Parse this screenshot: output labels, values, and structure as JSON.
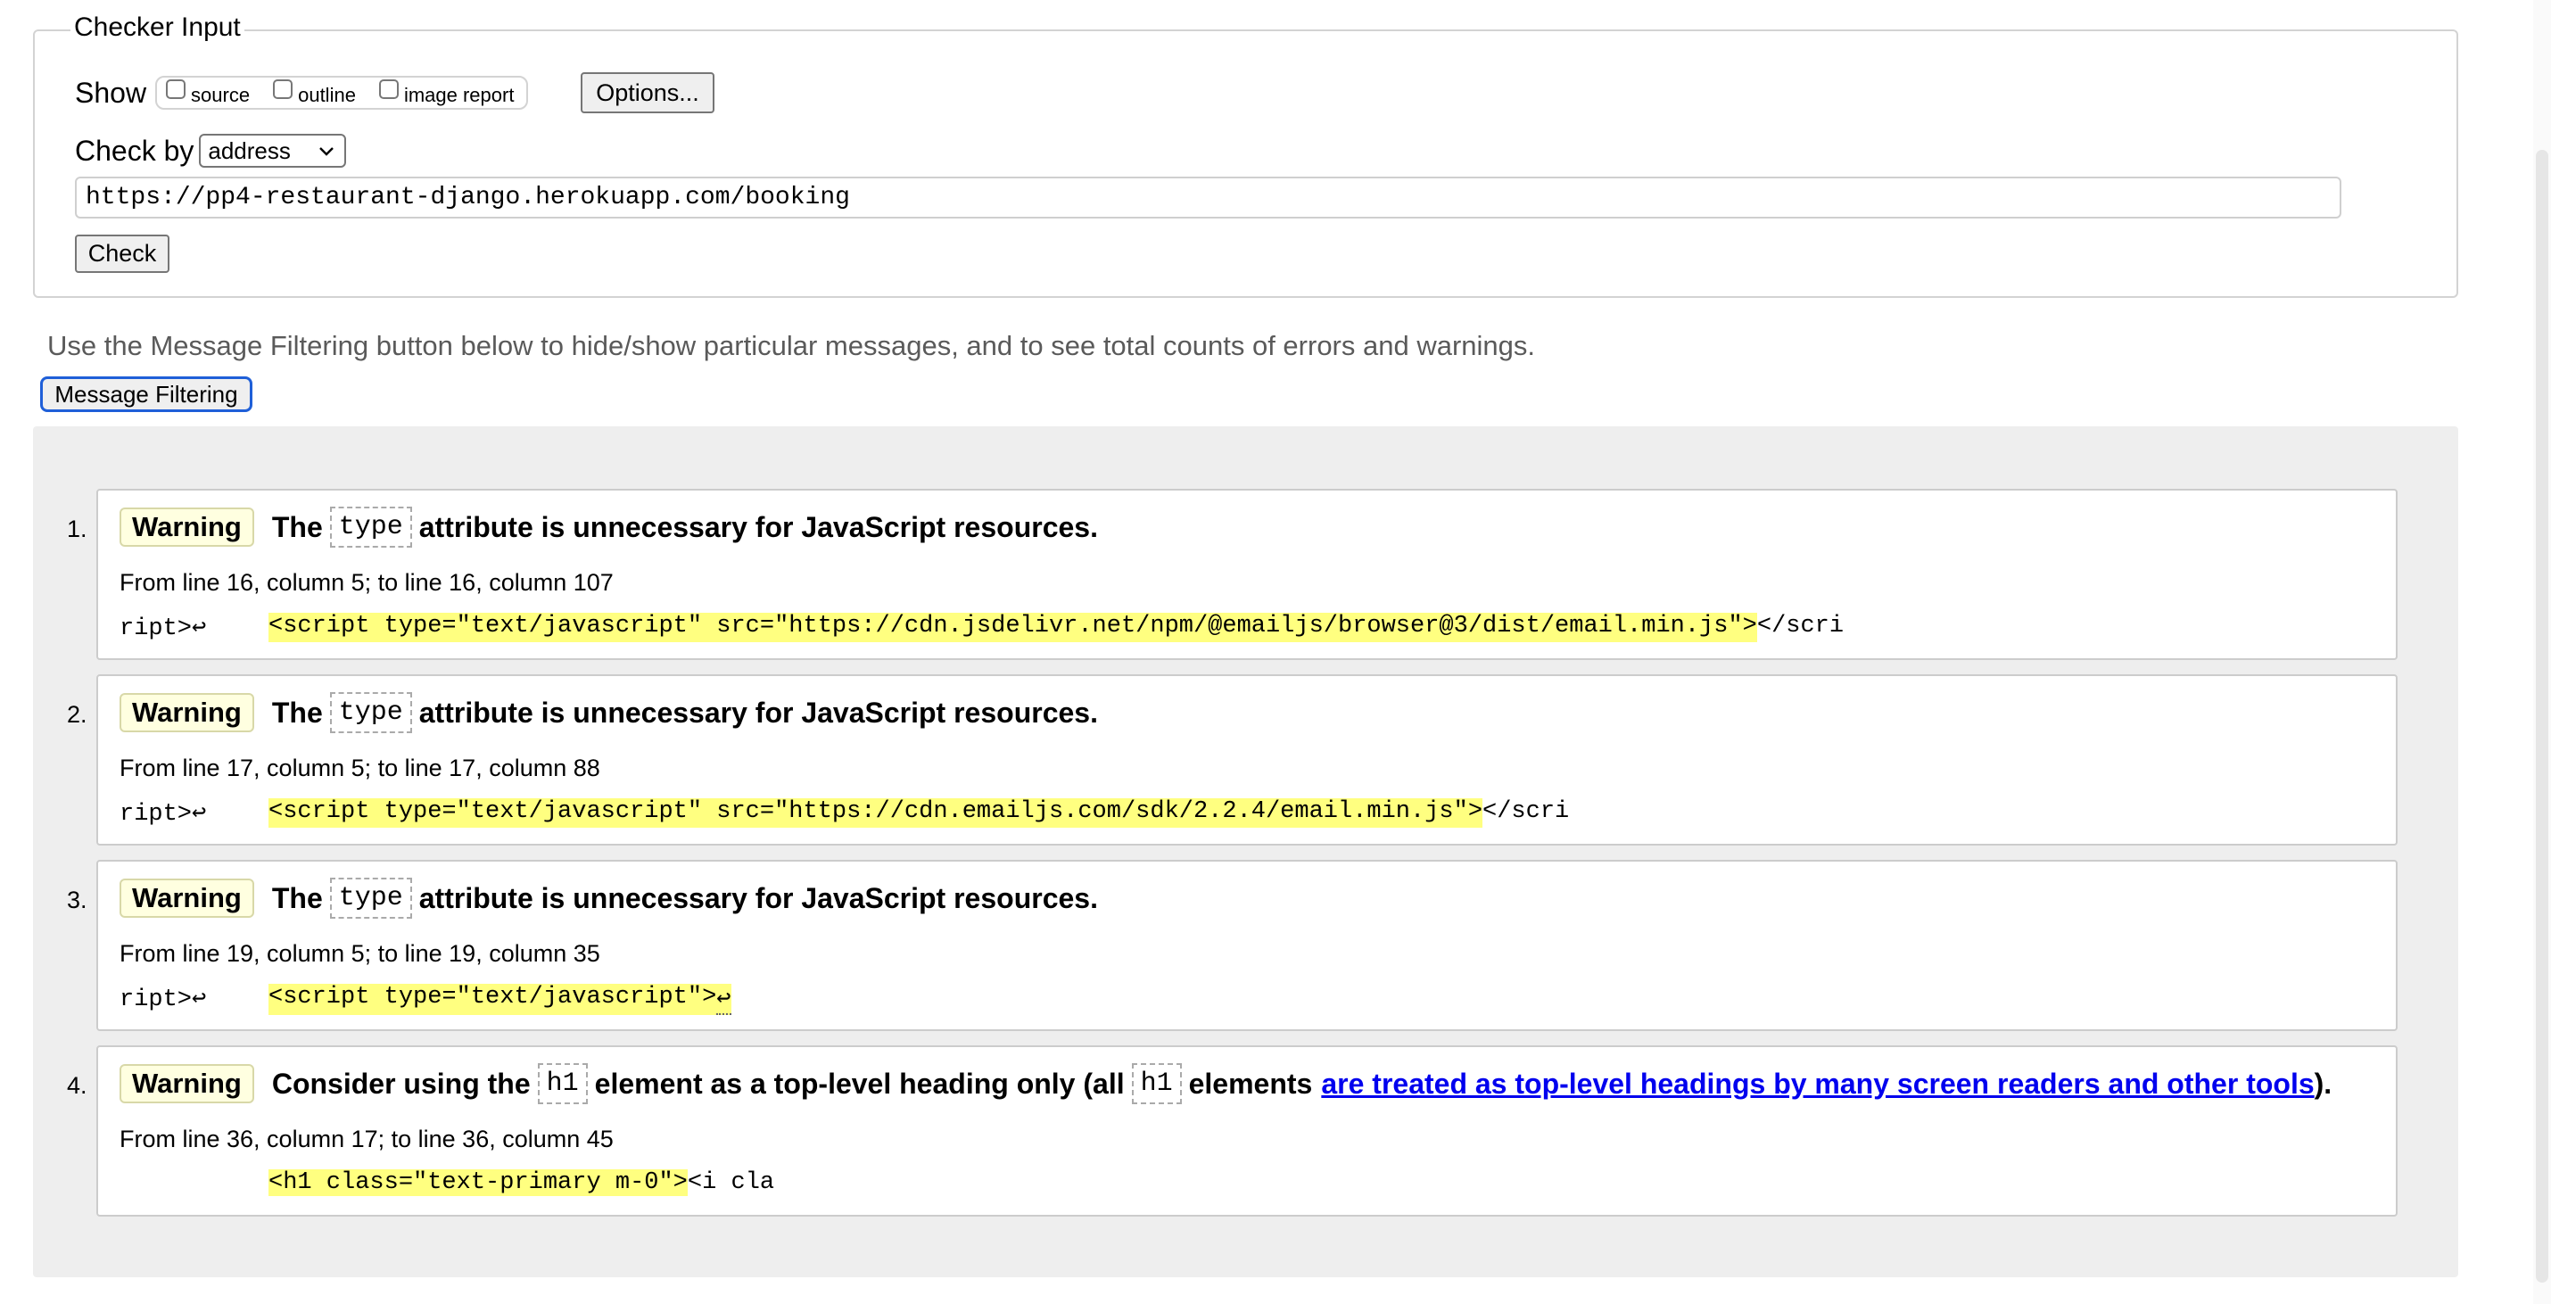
{
  "checker": {
    "legend": "Checker Input",
    "show_label": "Show",
    "show_options": [
      "source",
      "outline",
      "image report"
    ],
    "options_button": "Options...",
    "check_by_label": "Check by",
    "check_by_value": "address",
    "url_value": "https://pp4-restaurant-django.herokuapp.com/booking",
    "check_button": "Check"
  },
  "filter": {
    "note": "Use the Message Filtering button below to hide/show particular messages, and to see total counts of errors and warnings.",
    "button": "Message Filtering"
  },
  "messages": [
    {
      "number": "1.",
      "type": "Warning",
      "title_before": "The",
      "code": "type",
      "title_after": "attribute is unnecessary for JavaScript resources.",
      "location": "From line 16, column 5; to line 16, column 107",
      "extract_prefix": "ript>↩",
      "extract_highlight": "<script type=\"text/javascript\" src=\"https://cdn.jsdelivr.net/npm/@emailjs/browser@3/dist/email.min.js\">",
      "extract_suffix": "</scri"
    },
    {
      "number": "2.",
      "type": "Warning",
      "title_before": "The",
      "code": "type",
      "title_after": "attribute is unnecessary for JavaScript resources.",
      "location": "From line 17, column 5; to line 17, column 88",
      "extract_prefix": "ript>↩",
      "extract_highlight": "<script type=\"text/javascript\" src=\"https://cdn.emailjs.com/sdk/2.2.4/email.min.js\">",
      "extract_suffix": "</scri"
    },
    {
      "number": "3.",
      "type": "Warning",
      "title_before": "The",
      "code": "type",
      "title_after": "attribute is unnecessary for JavaScript resources.",
      "location": "From line 19, column 5; to line 19, column 35",
      "extract_prefix": "ript>↩",
      "extract_highlight": "<script type=\"text/javascript\">",
      "extract_return": "↩"
    },
    {
      "number": "4.",
      "type": "Warning",
      "title_before": "Consider using the",
      "code": "h1",
      "title_middle": "element as a top-level heading only (all",
      "code2": "h1",
      "title_after": "elements",
      "link_text": "are treated as top-level headings by many screen readers and other tools",
      "title_end": ").",
      "location": "From line 36, column 17; to line 36, column 45",
      "extract_highlight": "<h1 class=\"text-primary m-0\">",
      "extract_suffix": "<i cla"
    }
  ]
}
